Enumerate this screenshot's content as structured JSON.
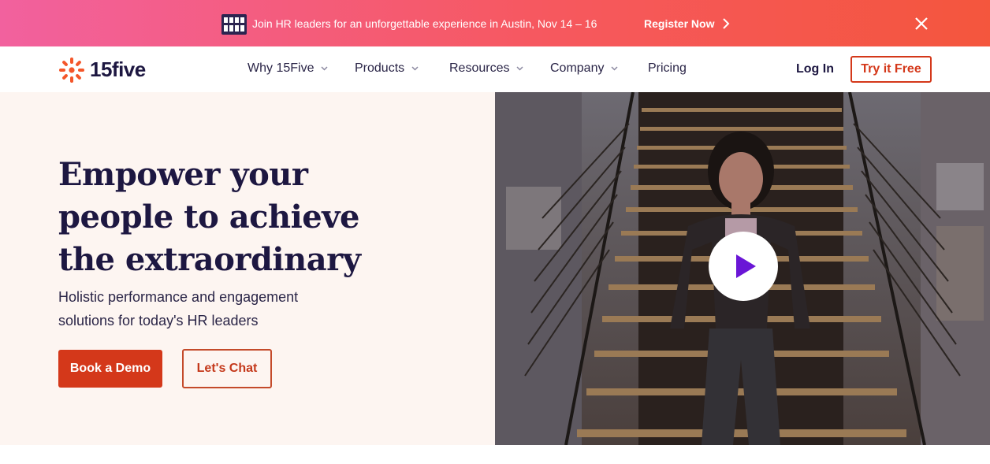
{
  "banner": {
    "logo_icon": "thrive-logo",
    "text": "Join HR leaders for an unforgettable experience in Austin, Nov 14 – 16",
    "cta_label": "Register Now",
    "cta_icon": "chevron-right-icon",
    "close_icon": "close-icon",
    "colors": {
      "gradient_start": "#f2619e",
      "gradient_end": "#f4563d"
    }
  },
  "nav": {
    "brand": "15five",
    "logo_icon": "sunburst-logo-icon",
    "items": [
      {
        "label": "Why 15Five",
        "has_dropdown": true
      },
      {
        "label": "Products",
        "has_dropdown": true
      },
      {
        "label": "Resources",
        "has_dropdown": true
      },
      {
        "label": "Company",
        "has_dropdown": true
      },
      {
        "label": "Pricing",
        "has_dropdown": false
      }
    ],
    "login_label": "Log In",
    "try_label": "Try it Free"
  },
  "hero": {
    "headline_lines": [
      "Empower your",
      "people to achieve",
      "the extraordinary"
    ],
    "subhead_lines": [
      "Holistic performance and engagement",
      "solutions for today's HR leaders"
    ],
    "primary_cta": "Book a Demo",
    "secondary_cta": "Let's Chat",
    "video_icon": "play-icon",
    "colors": {
      "accent": "#d4381a",
      "heading": "#1d1741",
      "background": "#fdf5f1",
      "play": "#6a16d6"
    }
  }
}
